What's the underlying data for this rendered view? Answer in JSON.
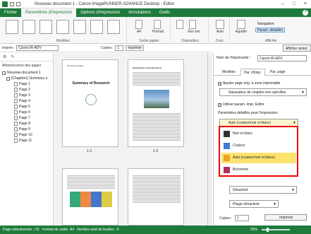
{
  "window": {
    "title": "Nouveau document 1 - Canon imageRUNNER ADVANCE Desktop - Editor",
    "minimize": "–",
    "maximize": "□",
    "close": "×"
  },
  "menu": {
    "tabs": [
      "Fichier",
      "Paramètres d'impression",
      "Options d'impression",
      "Annotations",
      "Outils"
    ],
    "active": "Paramètres d'impression",
    "help": "?"
  },
  "ribbon": {
    "groups": [
      "Modèles",
      "Sortie papier",
      "Disposition",
      "Coul.",
      "Afficher"
    ],
    "a4": "A4",
    "portrait": "Portrait",
    "rectoverso": "Rec-ver",
    "auto": "Auto",
    "agrafer": "Agrafer",
    "navigation": "Navigation",
    "param_details": "Param. détaillés"
  },
  "printbar": {
    "impr_label": "Imprim :",
    "printer": "Canon iR-ADV",
    "copies_label": "Copies :",
    "copies_value": "1",
    "print_button": "Imprimer"
  },
  "right_top": {
    "afficher_button": "Afficher annot."
  },
  "left_panel": {
    "title": "Arborescence des pages",
    "root": "Nouveau document 1",
    "chapter": "[Chapitre1] Summary o",
    "pages": [
      "Page 1",
      "Page 2",
      "Page 3",
      "Page 4",
      "Page 5",
      "Page 6",
      "Page 7",
      "Page 8",
      "Page 9",
      "Page 10",
      "Page 11"
    ]
  },
  "preview": {
    "labels": [
      "1-1",
      "1-2"
    ],
    "page1_title": "Summary of Research",
    "page2_heading": "Introduction of the Research"
  },
  "right_panel": {
    "printer_label": "Nom de l'imprimante :",
    "printer_value": "Canon iR-ADV",
    "tabs": [
      "Modèles",
      "Par. d'impr.",
      "Par. page"
    ],
    "active_tab": "Par. d'impr.",
    "ajuster": "Ajuster page orig. à zone imprimable",
    "separateur": "Séparateur de chapitre non spécifiés",
    "utiliser": "Utiliser param. impr. Editor",
    "detailed": "Paramètres détaillés pour l'impression",
    "color_value": "Auto (couleur/noir et blanc)",
    "desactive": "Désactivé",
    "pliage": "Pliage désactiver",
    "copies_label": "Copies :",
    "copies_value": "1",
    "imprimer": "Imprimer"
  },
  "color_options": [
    {
      "label": "Noir et blanc",
      "swatch": "#333333",
      "selected": false
    },
    {
      "label": "Couleur",
      "swatch": "#3b7dd8",
      "selected": false
    },
    {
      "label": "Auto (couleur/noir et blanc)",
      "swatch": "#f0a020",
      "selected": true
    },
    {
      "label": "Bichromie",
      "swatch": "#b03060",
      "selected": false
    }
  ],
  "status": {
    "page_sel": "Page sélectionnée : /11",
    "format": "Format de sortie :A4",
    "sheets": "Nombre total de feuilles : 6",
    "zoom": "25%"
  }
}
